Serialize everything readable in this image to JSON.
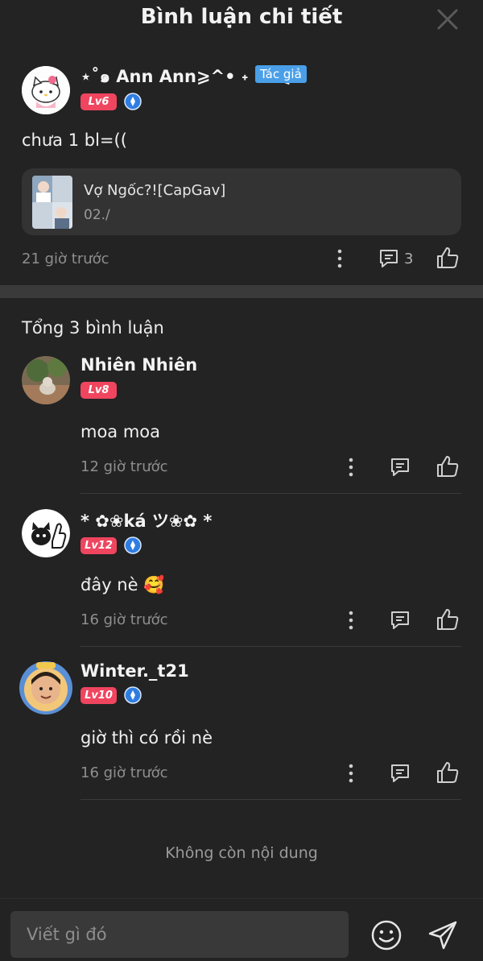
{
  "header": {
    "title": "Bình luận chi tiết"
  },
  "main_comment": {
    "user_name": "⋆˚๑ Ann Ann⩾^• ˖ • ͡ ̊⩽",
    "author_tag": "Tác giả",
    "level": "Lv6",
    "text": "chưa 1 bl=((",
    "quoted": {
      "title": "Vợ Ngốc?![CapGav]",
      "subtitle": "02./"
    },
    "time": "21 giờ trước",
    "reply_count": "3"
  },
  "total_label": "Tổng 3 bình luận",
  "replies": [
    {
      "user_name": "Nhiên Nhiên",
      "level": "Lv8",
      "text": "moa moa",
      "time": "12 giờ trước"
    },
    {
      "user_name": "* ✿❀ká ツ❀✿ *",
      "level": "Lv12",
      "text": "đây nè 🥰",
      "time": "16 giờ trước"
    },
    {
      "user_name": "Winter._t21",
      "level": "Lv10",
      "text": "giờ thì có rồi nè",
      "time": "16 giờ trước"
    }
  ],
  "end_text": "Không còn nội dung",
  "footer": {
    "input_placeholder": "Viết gì đó"
  },
  "colors": {
    "background": "#232323",
    "level_badge": "#f0455f",
    "author_tag": "#4a9fe8",
    "verify_badge": "#2f7de1"
  }
}
